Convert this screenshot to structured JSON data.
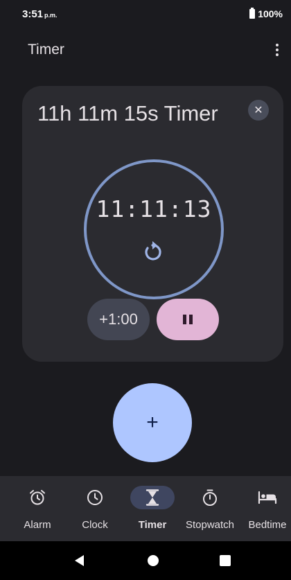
{
  "status_bar": {
    "time": "3:51",
    "ampm": "p.m.",
    "battery": "100%"
  },
  "app_bar": {
    "title": "Timer",
    "menu_icon": "more-vert-icon"
  },
  "timer_card": {
    "label": "11h 11m 15s Timer",
    "remaining": "11:11:13",
    "progress": 1.0,
    "close_icon": "close-icon",
    "close_glyph": "✕",
    "reset_icon": "reset-icon",
    "add_minute_label": "+1:00",
    "pause_icon": "pause-icon"
  },
  "fab": {
    "glyph": "+",
    "icon": "add-icon"
  },
  "colors": {
    "background": "#1b1b1f",
    "card": "#2b2b30",
    "ring": "#7f97c8",
    "accent": "#aec6ff",
    "pause": "#e2b5d6"
  },
  "bottom_nav": {
    "items": [
      {
        "label": "Alarm",
        "icon": "alarm-icon",
        "active": false
      },
      {
        "label": "Clock",
        "icon": "clock-icon",
        "active": false
      },
      {
        "label": "Timer",
        "icon": "hourglass-icon",
        "active": true
      },
      {
        "label": "Stopwatch",
        "icon": "stopwatch-icon",
        "active": false
      },
      {
        "label": "Bedtime",
        "icon": "bed-icon",
        "active": false
      }
    ]
  },
  "system_nav": {
    "back_icon": "back-icon",
    "home_icon": "home-icon",
    "recents_icon": "recents-icon"
  }
}
